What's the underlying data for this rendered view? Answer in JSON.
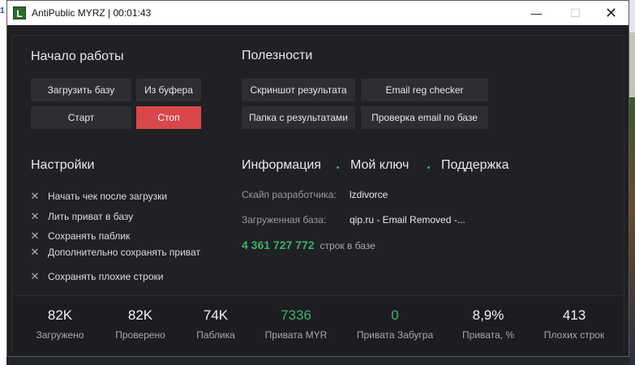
{
  "desktop": {
    "left_number": "1"
  },
  "window": {
    "title": "AntiPublic MYRZ | 00:01:43",
    "icon_letter": "L",
    "controls": {
      "minimize": "—",
      "maximize": "☐",
      "close": "✕"
    }
  },
  "start": {
    "heading": "Начало работы",
    "load_base": "Загрузить базу",
    "from_clipboard": "Из буфера",
    "start": "Старт",
    "stop": "Стоп"
  },
  "tools": {
    "heading": "Полезности",
    "screenshot": "Скриншот результата",
    "email_reg_checker": "Email reg checker",
    "results_folder": "Папка с результатами",
    "check_email": "Проверка email по базе"
  },
  "settings": {
    "heading": "Настройки",
    "options": [
      "Начать чек после загрузки",
      "Лить приват в базу",
      "Сохранять паблик",
      "Дополнительно сохранять приват",
      "Сохранять плохие строки"
    ]
  },
  "info": {
    "tab_info": "Информация",
    "tab_key": "Мой ключ",
    "tab_support": "Поддержка",
    "skype_label": "Скайп разработчика:",
    "skype_value": "lzdivorce",
    "base_label": "Загруженная база:",
    "base_value": "qip.ru - Email Removed -...",
    "rows_count": "4 361 727 772",
    "rows_label": "строк в базе"
  },
  "stats": [
    {
      "value": "82K",
      "label": "Загружено"
    },
    {
      "value": "82K",
      "label": "Проверено"
    },
    {
      "value": "74K",
      "label": "Паблика"
    },
    {
      "value": "7336",
      "label": "Привата MYR"
    },
    {
      "value": "0",
      "label": "Привата Забугра"
    },
    {
      "value": "8,9%",
      "label": "Привата, %"
    },
    {
      "value": "413",
      "label": "Плохих строк"
    }
  ],
  "colors": {
    "accent_green": "#3fae6a",
    "stop_red": "#d9474a",
    "background": "#202124"
  }
}
